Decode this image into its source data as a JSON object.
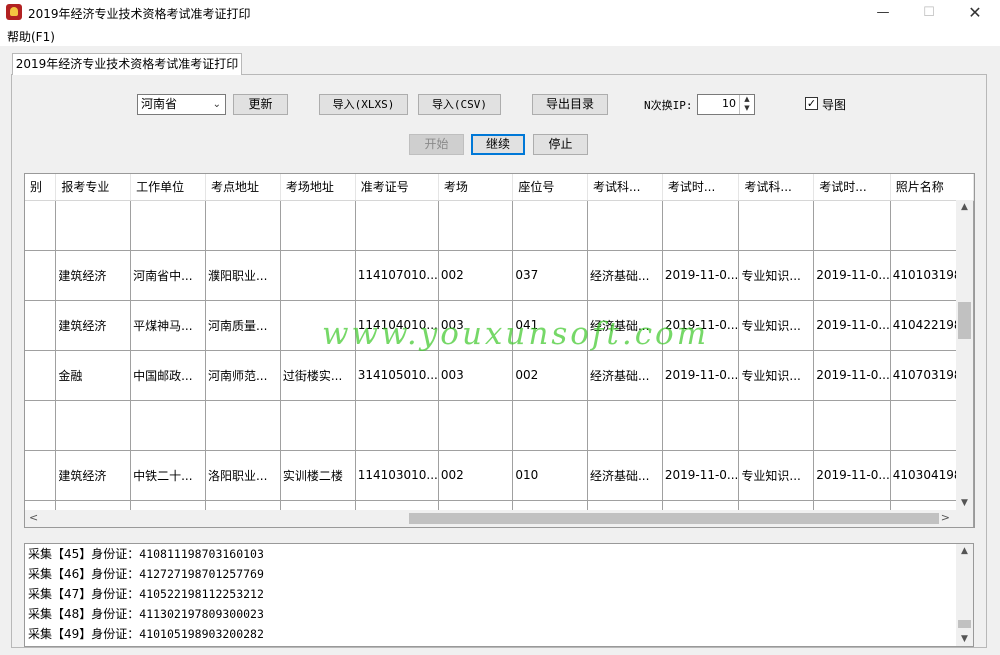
{
  "window": {
    "title": "2019年经济专业技术资格考试准考证打印",
    "minimize": "—",
    "maximize": "☐",
    "close": "✕"
  },
  "menu": {
    "help": "帮助(F1)"
  },
  "tab": {
    "label": "2019年经济专业技术资格考试准考证打印"
  },
  "controls": {
    "province": "河南省",
    "update": "更新",
    "import_xlsx": "导入(XLXS)",
    "import_csv": "导入(CSV)",
    "export_dir": "导出目录",
    "switch_ip_label": "N次换IP:",
    "switch_ip_value": "10",
    "guide_label": "导图",
    "guide_checked": "✓",
    "start": "开始",
    "continue": "继续",
    "stop": "停止"
  },
  "table": {
    "columns": [
      "别",
      "报考专业",
      "工作单位",
      "考点地址",
      "考场地址",
      "准考证号",
      "考场",
      "座位号",
      "考试科...",
      "考试时...",
      "考试科...",
      "考试时...",
      "照片名称"
    ],
    "rows": [
      [
        "",
        "",
        "",
        "",
        "",
        "",
        "",
        "",
        "",
        "",
        "",
        "",
        ""
      ],
      [
        "",
        "建筑经济",
        "河南省中...",
        "濮阳职业...",
        "",
        "114107010...",
        "002",
        "037",
        "经济基础...",
        "2019-11-0...",
        "专业知识...",
        "2019-11-0...",
        "410103198..."
      ],
      [
        "",
        "建筑经济",
        "平煤神马...",
        "河南质量...",
        "",
        "114104010...",
        "003",
        "041",
        "经济基础...",
        "2019-11-0...",
        "专业知识...",
        "2019-11-0...",
        "410422198..."
      ],
      [
        "",
        "金融",
        "中国邮政...",
        "河南师范...",
        "过街楼实...",
        "314105010...",
        "003",
        "002",
        "经济基础...",
        "2019-11-0...",
        "专业知识...",
        "2019-11-0...",
        "410703198..."
      ],
      [
        "",
        "",
        "",
        "",
        "",
        "",
        "",
        "",
        "",
        "",
        "",
        "",
        ""
      ],
      [
        "",
        "建筑经济",
        "中铁二十...",
        "洛阳职业...",
        "实训楼二楼",
        "114103010...",
        "002",
        "010",
        "经济基础...",
        "2019-11-0...",
        "专业知识...",
        "2019-11-0...",
        "410304198..."
      ],
      [
        "",
        "",
        "",
        "",
        "",
        "",
        "",
        "",
        "",
        "",
        "",
        "",
        ""
      ]
    ]
  },
  "watermark": "www.youxunsoft.com",
  "log": [
    {
      "prefix": "采集【45】身份证：",
      "id": "410811198703160103"
    },
    {
      "prefix": "采集【46】身份证：",
      "id": "412727198701257769"
    },
    {
      "prefix": "采集【47】身份证：",
      "id": "410522198112253212"
    },
    {
      "prefix": "采集【48】身份证：",
      "id": "411302197809300023"
    },
    {
      "prefix": "采集【49】身份证：",
      "id": "410105198903200282"
    }
  ],
  "scroll_glyphs": {
    "up": "▲",
    "down": "▼",
    "left": "<",
    "right": ">",
    "select": "⌄"
  }
}
